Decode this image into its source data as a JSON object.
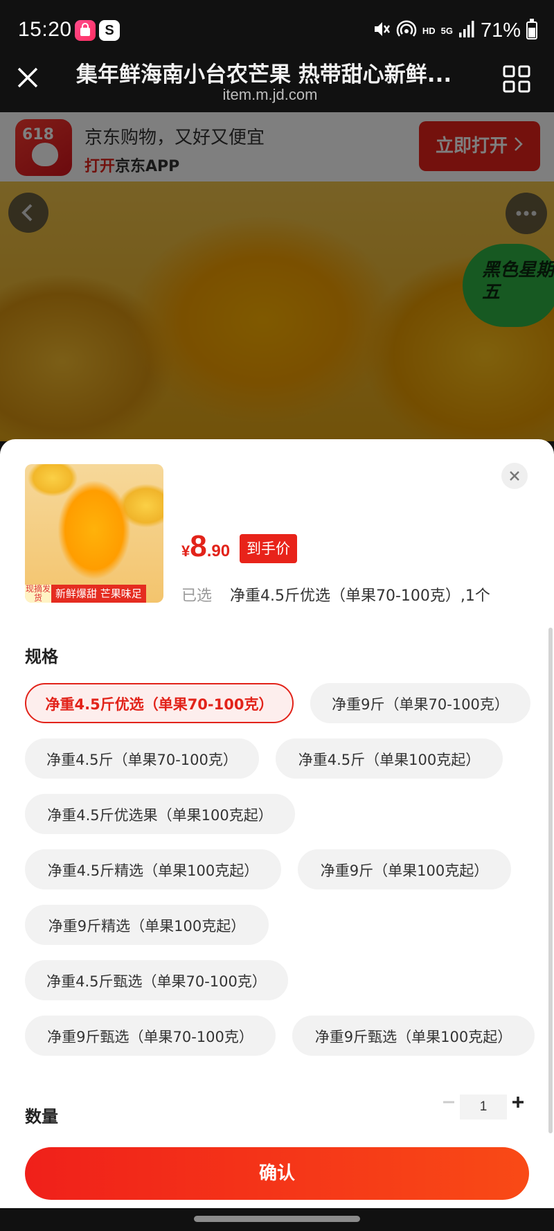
{
  "status_bar": {
    "time": "15:20",
    "network_hd": "HD",
    "network_5g": "5G",
    "battery": "71%",
    "icons": [
      "shopping-bag-app-icon",
      "s-app-icon",
      "mute-icon",
      "hotspot-icon",
      "signal-icon",
      "battery-icon"
    ]
  },
  "browser": {
    "title": "集年鲜海南小台农芒果 热带甜心新鲜...",
    "url": "item.m.jd.com"
  },
  "banner": {
    "logo_text": "618",
    "line1": "京东购物，又好又便宜",
    "line2_highlight": "打开",
    "line2_rest": "京东APP",
    "open_button": "立即打开"
  },
  "hero": {
    "promo": "黑色星期五"
  },
  "sheet": {
    "thumb_tag_small": "现摘发货",
    "thumb_tag": "新鲜爆甜 芒果味足",
    "price_symbol": "¥",
    "price_int": "8",
    "price_dec": ".90",
    "price_tag": "到手价",
    "selected_label": "已选",
    "selected_value": "净重4.5斤优选（单果70-100克）,1个",
    "spec_title": "规格",
    "specs": [
      "净重4.5斤优选（单果70-100克）",
      "净重9斤（单果70-100克）",
      "净重4.5斤（单果70-100克）",
      "净重4.5斤（单果100克起）",
      "净重4.5斤优选果（单果100克起）",
      "净重4.5斤精选（单果100克起）",
      "净重9斤（单果100克起）",
      "净重9斤精选（单果100克起）",
      "净重4.5斤甄选（单果70-100克）",
      "净重9斤甄选（单果70-100克）",
      "净重9斤甄选（单果100克起）"
    ],
    "selected_spec_index": 0,
    "qty_label": "数量",
    "qty_value": "1",
    "confirm": "确认"
  },
  "colors": {
    "accent": "#e2231a",
    "selected_chip_bg": "#fdeeed",
    "chip_bg": "#f2f2f2"
  }
}
